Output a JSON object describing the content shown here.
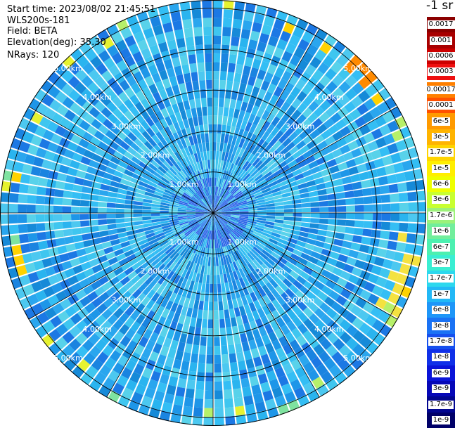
{
  "header": {
    "start_time": "Start time: 2023/08/02 21:45:51",
    "instrument": "WLS200s-181",
    "field": "Field: BETA",
    "elevation": "Elevation(deg): 35.30",
    "nrays": "NRays: 120"
  },
  "chart_data": {
    "type": "ppi-scan",
    "field": "BETA",
    "units": "-1 sr",
    "n_rays": 120,
    "elevation_deg": 35.3,
    "range_rings": {
      "values_km": [
        1.0,
        2.0,
        3.0,
        4.0,
        5.0
      ],
      "labels": [
        "1.00km",
        "2.00km",
        "3.00km",
        "4.00km",
        "5.00km"
      ]
    },
    "spokes_deg": [
      0,
      30,
      60,
      90,
      120,
      150,
      180,
      210,
      240,
      270,
      300,
      330
    ],
    "colorbar": {
      "upper_labels": [
        "0.0017",
        "0.001",
        "0.0006",
        "0.0003"
      ],
      "upper_colors": [
        "#8b0000",
        "#a80000",
        "#cc0000",
        "#ee1010"
      ],
      "lower_labels": [
        "0.00017",
        "0.0001",
        "6e-5",
        "3e-5",
        "1.7e-5",
        "1e-5",
        "6e-6",
        "3e-6",
        "1.7e-6",
        "1e-6",
        "6e-7",
        "3e-7",
        "1.7e-7",
        "1e-7",
        "6e-8",
        "3e-8",
        "1.7e-8",
        "1e-8",
        "6e-9",
        "3e-9",
        "1.7e-9",
        "1e-9"
      ],
      "lower_colors": [
        "#ff8000",
        "#ff5000",
        "#ff9a00",
        "#ffb400",
        "#ffd400",
        "#ffee00",
        "#eeff00",
        "#c8ff30",
        "#9cf27a",
        "#72ee9c",
        "#4cf0b0",
        "#3aeed2",
        "#2cd8ee",
        "#22b8f6",
        "#1e96f8",
        "#1a72f4",
        "#1650ee",
        "#1030e8",
        "#0a14d8",
        "#0608b8",
        "#020690",
        "#000068"
      ]
    }
  }
}
